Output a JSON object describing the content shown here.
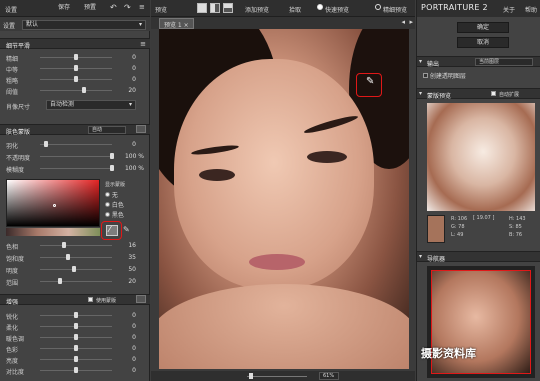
{
  "left_toolbar": {
    "settings": "设置",
    "save": "保存",
    "preset": "预置"
  },
  "preset": {
    "value": "默认"
  },
  "detail": {
    "title": "细节平滑",
    "rows": [
      {
        "label": "精细",
        "value": "0"
      },
      {
        "label": "中等",
        "value": "0"
      },
      {
        "label": "粗略",
        "value": "0"
      },
      {
        "label": "阈值",
        "value": "20"
      }
    ],
    "feature_label": "肖像尺寸",
    "feature_value": "自动检测"
  },
  "skin": {
    "title": "肤色蒙版",
    "mode": "自动",
    "feather_label": "羽化",
    "feather_value": "0",
    "opacity_label": "不透明度",
    "opacity_value": "100 %",
    "fuzz_label": "模糊度",
    "fuzz_value": "100 %",
    "display_title": "显示蒙版",
    "radios": [
      "无",
      "白色",
      "黑色"
    ],
    "rows": [
      {
        "label": "色相",
        "value": "16"
      },
      {
        "label": "饱和度",
        "value": "35"
      },
      {
        "label": "明度",
        "value": "50"
      },
      {
        "label": "范围",
        "value": "20"
      }
    ]
  },
  "enhance": {
    "title": "增强",
    "use_mask": "使用蒙版",
    "rows": [
      {
        "label": "锐化",
        "value": "0"
      },
      {
        "label": "柔化",
        "value": "0"
      },
      {
        "label": "暖色调",
        "value": "0"
      },
      {
        "label": "色彩",
        "value": "0"
      },
      {
        "label": "亮度",
        "value": "0"
      },
      {
        "label": "对比度",
        "value": "0"
      }
    ]
  },
  "center": {
    "preview_label": "预览",
    "add_preview": "添加预览",
    "fit": "拾取",
    "quick": "快速预览",
    "fine": "精细预览",
    "tab": "预览 1",
    "zoom": "61%"
  },
  "right": {
    "app_title": "PORTRAITURE 2",
    "about": "关于",
    "help": "帮助",
    "ok": "确定",
    "cancel": "取消",
    "output_title": "输出",
    "output_value": "当前图层",
    "new_layer": "创建透明图层",
    "mask_title": "蒙版预览",
    "auto_expand": "自动扩展",
    "readout": {
      "r": "R: 106",
      "g": "G: 78",
      "b": "B: 67",
      "h": "H: 143",
      "s": "S: 85",
      "bb": "B: 76",
      "l": "L: 49",
      "l2": "[ 19.07 ]"
    },
    "nav_title": "导航器"
  },
  "watermark": "摄影资料库",
  "colors": {
    "accent_red": "#e01818",
    "panel": "#434343",
    "dark": "#2f2f2f",
    "sample": "#a5735b"
  }
}
